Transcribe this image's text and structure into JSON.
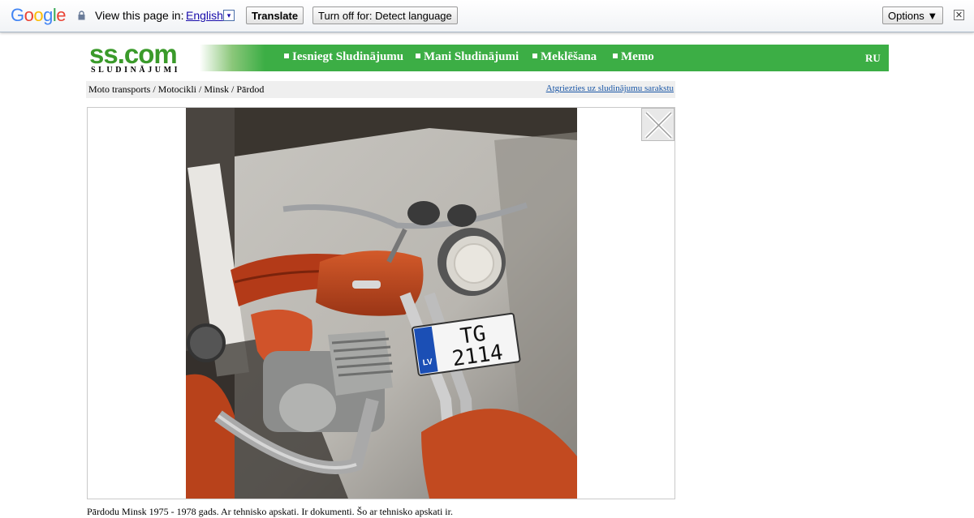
{
  "translate_bar": {
    "logo": "Google",
    "view_text": "View this page in:",
    "language": "English",
    "translate_label": "Translate",
    "turn_off_label": "Turn off for: Detect language",
    "options_label": "Options ▼",
    "close_label": "✕"
  },
  "site": {
    "logo_main": "ss.com",
    "logo_sub": "SLUDINĀJUMI",
    "nav": [
      {
        "label": "Iesniegt Sludinājumu"
      },
      {
        "label": "Mani Sludinājumi"
      },
      {
        "label": "Meklēšana"
      },
      {
        "label": "Memo"
      }
    ],
    "lang_switch": "RU",
    "accent_color": "#3cae45"
  },
  "breadcrumb": {
    "path": "Moto transports / Motocikli / Minsk / Pārdod",
    "back_link": "Atgriezties uz sludinājumu sarakstu"
  },
  "viewer": {
    "photo_plate_line1": "TG",
    "photo_plate_line2": "2114",
    "photo_plate_country": "LV",
    "close_icon": "close-x-icon"
  },
  "description_excerpt": "Pārdodu Minsk 1975 - 1978 gads. Ar tehnisko apskati. Ir dokumenti. Šo ar tehnisko apskati ir."
}
